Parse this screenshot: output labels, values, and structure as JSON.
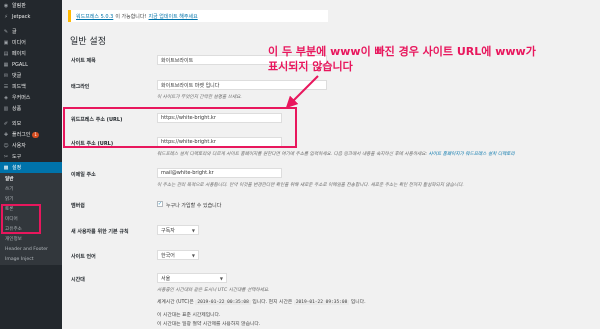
{
  "sidebar": {
    "items": [
      {
        "icon": "dashboard-icon",
        "glyph": "◉",
        "label": "알림판"
      },
      {
        "icon": "jetpack-icon",
        "glyph": "⚡",
        "label": "Jetpack"
      },
      {
        "icon": "posts-icon",
        "glyph": "✎",
        "label": "글"
      },
      {
        "icon": "media-icon",
        "glyph": "▣",
        "label": "미디어"
      },
      {
        "icon": "pages-icon",
        "glyph": "▤",
        "label": "페이지"
      },
      {
        "icon": "pgall-icon",
        "glyph": "▦",
        "label": "PGALL"
      },
      {
        "icon": "comments-icon",
        "glyph": "✉",
        "label": "댓글"
      },
      {
        "icon": "feedback-icon",
        "glyph": "☰",
        "label": "피드백"
      },
      {
        "icon": "woocommerce-icon",
        "glyph": "◈",
        "label": "우커머스"
      },
      {
        "icon": "products-icon",
        "glyph": "▥",
        "label": "상품"
      },
      {
        "icon": "appearance-icon",
        "glyph": "✐",
        "label": "외모"
      },
      {
        "icon": "plugins-icon",
        "glyph": "✚",
        "label": "플러그인",
        "badge": "1"
      },
      {
        "icon": "users-icon",
        "glyph": "☺",
        "label": "사용자"
      },
      {
        "icon": "tools-icon",
        "glyph": "✂",
        "label": "도구"
      },
      {
        "icon": "settings-icon",
        "glyph": "▩",
        "label": "설정"
      }
    ],
    "submenu": [
      "일반",
      "쓰기",
      "읽기",
      "토론",
      "미디어",
      "고유주소",
      "개인정보",
      "Header and Footer",
      "Image Inject"
    ]
  },
  "notice": {
    "link": "워드프레스 5.0.3",
    "text": "이 가능합니다!",
    "link2": "지금 업데이트 해주세요"
  },
  "page_title": "일반 설정",
  "fields": {
    "site_title": {
      "label": "사이트 제목",
      "value": "화이트브라이트"
    },
    "tagline": {
      "label": "태그라인",
      "value": "화이트브라이트 마켓 입니다",
      "desc": "이 사이트가 무엇인지 간략한 설명을 쓰세요."
    },
    "wp_url": {
      "label": "워드프레스 주소 (URL)",
      "value": "https://white-bright.kr"
    },
    "site_url": {
      "label": "사이트 주소 (URL)",
      "value": "https://white-bright.kr",
      "desc": "워드프레스 설치 디렉토리와 다르게 사이트 홈페이지를 원한다면 여기에 주소를 입력하세요. 다음 링크에서 내용을 숙지하신 후에 사용하세요:",
      "desc_link": "사이트 홈페이지가 워드프레스 설치 디렉토리"
    },
    "admin_email": {
      "label": "이메일 주소",
      "value": "mail@white-bright.kr",
      "desc": "이 주소는 관리 목적으로 사용됩니다. 만약 이것을 변경한다면 확인을 위해 새로운 주소로 이메일을 전송합니다. 새로운 주소는 확인 전까지 활성화되지 않습니다."
    },
    "membership": {
      "label": "멤버쉽",
      "checkbox": "누구나 가입할 수 있습니다"
    },
    "default_role": {
      "label": "새 사용자를 위한 기본 규칙",
      "value": "구독자"
    },
    "site_language": {
      "label": "사이트 언어",
      "value": "한국어"
    },
    "timezone": {
      "label": "시간대",
      "value": "서울",
      "desc": "사용중인 시간대와 같은 도시나 UTC 시간대를 선택하세요.",
      "utc_label": "세계시간 (UTC)은",
      "utc_time": "2019-01-22 00:35:08",
      "utc_suffix": "입니다. 현지 시간은",
      "local_time": "2019-01-22 09:35:08",
      "local_suffix": "입니다.",
      "line3": "이 시간대는 표준 시간제입니다.",
      "line4": "이 시간대는 일광 절약 시간제를 사용하지 않습니다."
    }
  },
  "callout": {
    "line1": "이 두 부분에 www이 빠진 경우 사이트 URL에 www가",
    "line2": "표시되지 않습니다"
  }
}
